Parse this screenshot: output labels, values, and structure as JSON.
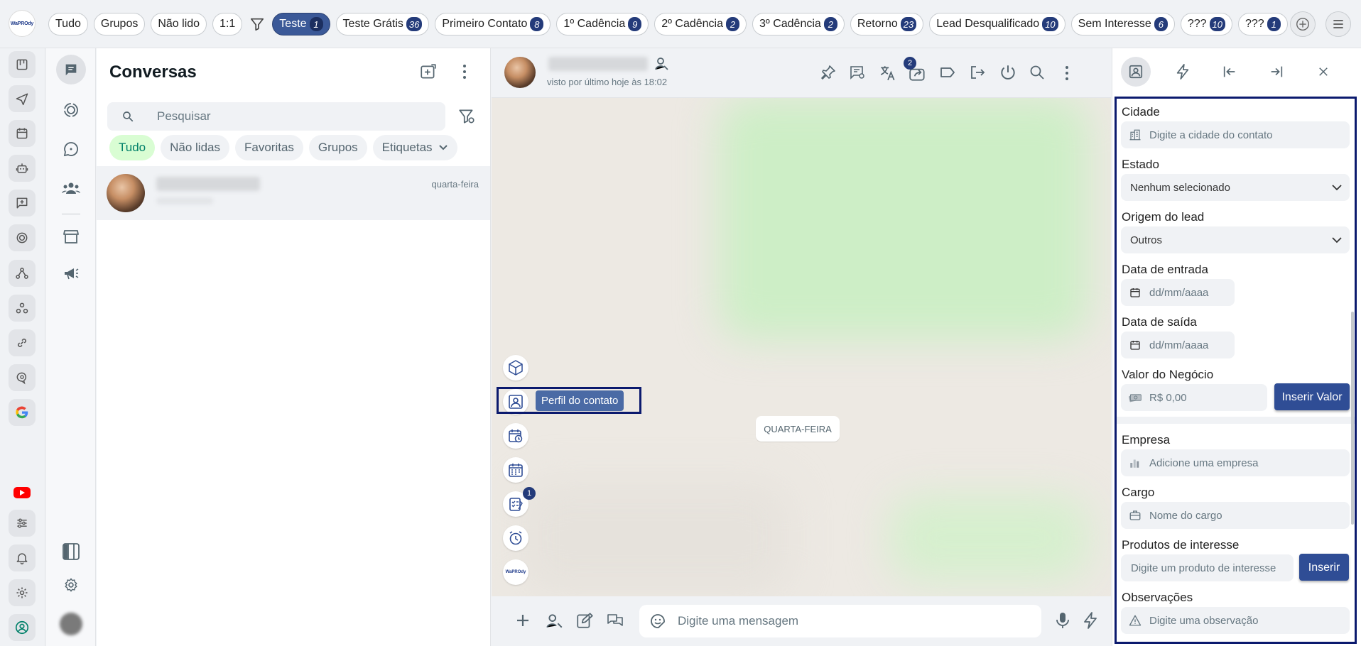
{
  "topbar": {
    "logo_text": "WaPROdy",
    "chips": [
      {
        "label": "Tudo",
        "count": ""
      },
      {
        "label": "Grupos",
        "count": ""
      },
      {
        "label": "Não lido",
        "count": ""
      },
      {
        "label": "1:1",
        "count": ""
      }
    ],
    "tag_chips": [
      {
        "label": "Teste",
        "count": "1",
        "selected": true
      },
      {
        "label": "Teste Grátis",
        "count": "36"
      },
      {
        "label": "Primeiro Contato",
        "count": "8"
      },
      {
        "label": "1º Cadência",
        "count": "9"
      },
      {
        "label": "2º Cadência",
        "count": "2"
      },
      {
        "label": "3º Cadência",
        "count": "2"
      },
      {
        "label": "Retorno",
        "count": "23"
      },
      {
        "label": "Lead Desqualificado",
        "count": "10"
      },
      {
        "label": "Sem Interesse",
        "count": "6"
      },
      {
        "label": "???",
        "count": "10"
      },
      {
        "label": "???",
        "count": "1"
      }
    ]
  },
  "conversations": {
    "title": "Conversas",
    "search_placeholder": "Pesquisar",
    "filters": [
      "Tudo",
      "Não lidas",
      "Favoritas",
      "Grupos",
      "Etiquetas"
    ],
    "items": [
      {
        "time": "quarta-feira"
      }
    ]
  },
  "chat": {
    "status": "visto por último hoje às 18:02",
    "translate_badge": "2",
    "day_divider": "QUARTA-FEIRA",
    "tooltip": "Perfil do contato",
    "task_badge": "1",
    "message_placeholder": "Digite uma mensagem",
    "logo_text": "WaPROdy"
  },
  "contact_form": {
    "cidade_label": "Cidade",
    "cidade_placeholder": "Digite a cidade do contato",
    "estado_label": "Estado",
    "estado_value": "Nenhum selecionado",
    "origem_label": "Origem do lead",
    "origem_value": "Outros",
    "entrada_label": "Data de entrada",
    "entrada_placeholder": "dd/mm/aaaa",
    "saida_label": "Data de saída",
    "saida_placeholder": "dd/mm/aaaa",
    "valor_label": "Valor do Negócio",
    "valor_value": "R$ 0,00",
    "valor_button": "Inserir Valor",
    "empresa_label": "Empresa",
    "empresa_placeholder": "Adicione uma empresa",
    "cargo_label": "Cargo",
    "cargo_placeholder": "Nome do cargo",
    "produtos_label": "Produtos de interesse",
    "produtos_placeholder": "Digite um produto de interesse",
    "produtos_button": "Inserir",
    "obs_label": "Observações",
    "obs_placeholder": "Digite uma observação"
  },
  "colors": {
    "accent": "#3b5998",
    "badge": "#243b7a",
    "highlight_border": "#0b1a6e",
    "active_filter": "#d9fdd3"
  }
}
